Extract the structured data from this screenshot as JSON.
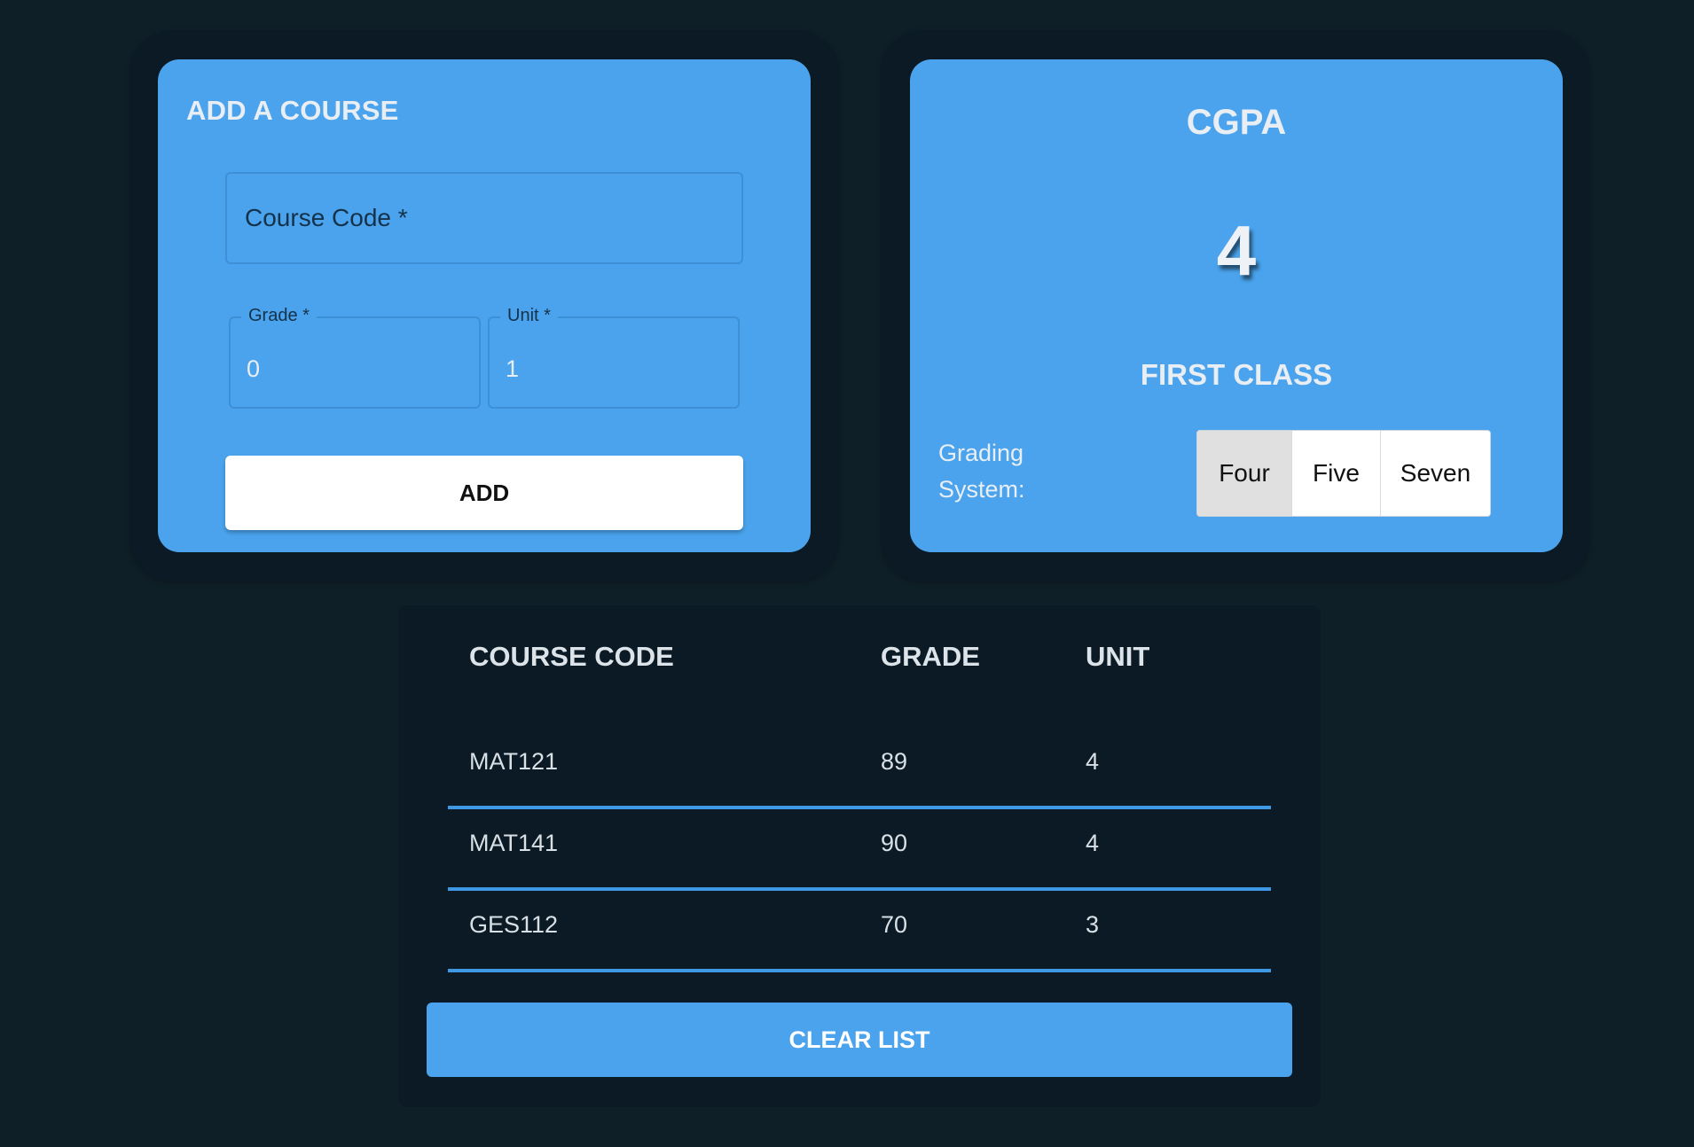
{
  "add_course": {
    "title": "ADD A COURSE",
    "course_code_placeholder": "Course Code *",
    "grade_label": "Grade *",
    "grade_value": "0",
    "unit_label": "Unit *",
    "unit_value": "1",
    "add_button": "ADD"
  },
  "cgpa": {
    "title": "CGPA",
    "value": "4",
    "classification": "FIRST CLASS",
    "grading_label": "Grading System:",
    "options": [
      "Four",
      "Five",
      "Seven"
    ],
    "selected": "Four"
  },
  "table": {
    "headers": [
      "COURSE CODE",
      "GRADE",
      "UNIT"
    ],
    "rows": [
      {
        "code": "MAT121",
        "grade": "89",
        "unit": "4"
      },
      {
        "code": "MAT141",
        "grade": "90",
        "unit": "4"
      },
      {
        "code": "GES112",
        "grade": "70",
        "unit": "3"
      }
    ],
    "clear_button": "CLEAR LIST"
  },
  "colors": {
    "background": "#0f1f27",
    "panel": "#0b1a24",
    "accent": "#4aa3ec",
    "divider": "#3f98e4"
  }
}
